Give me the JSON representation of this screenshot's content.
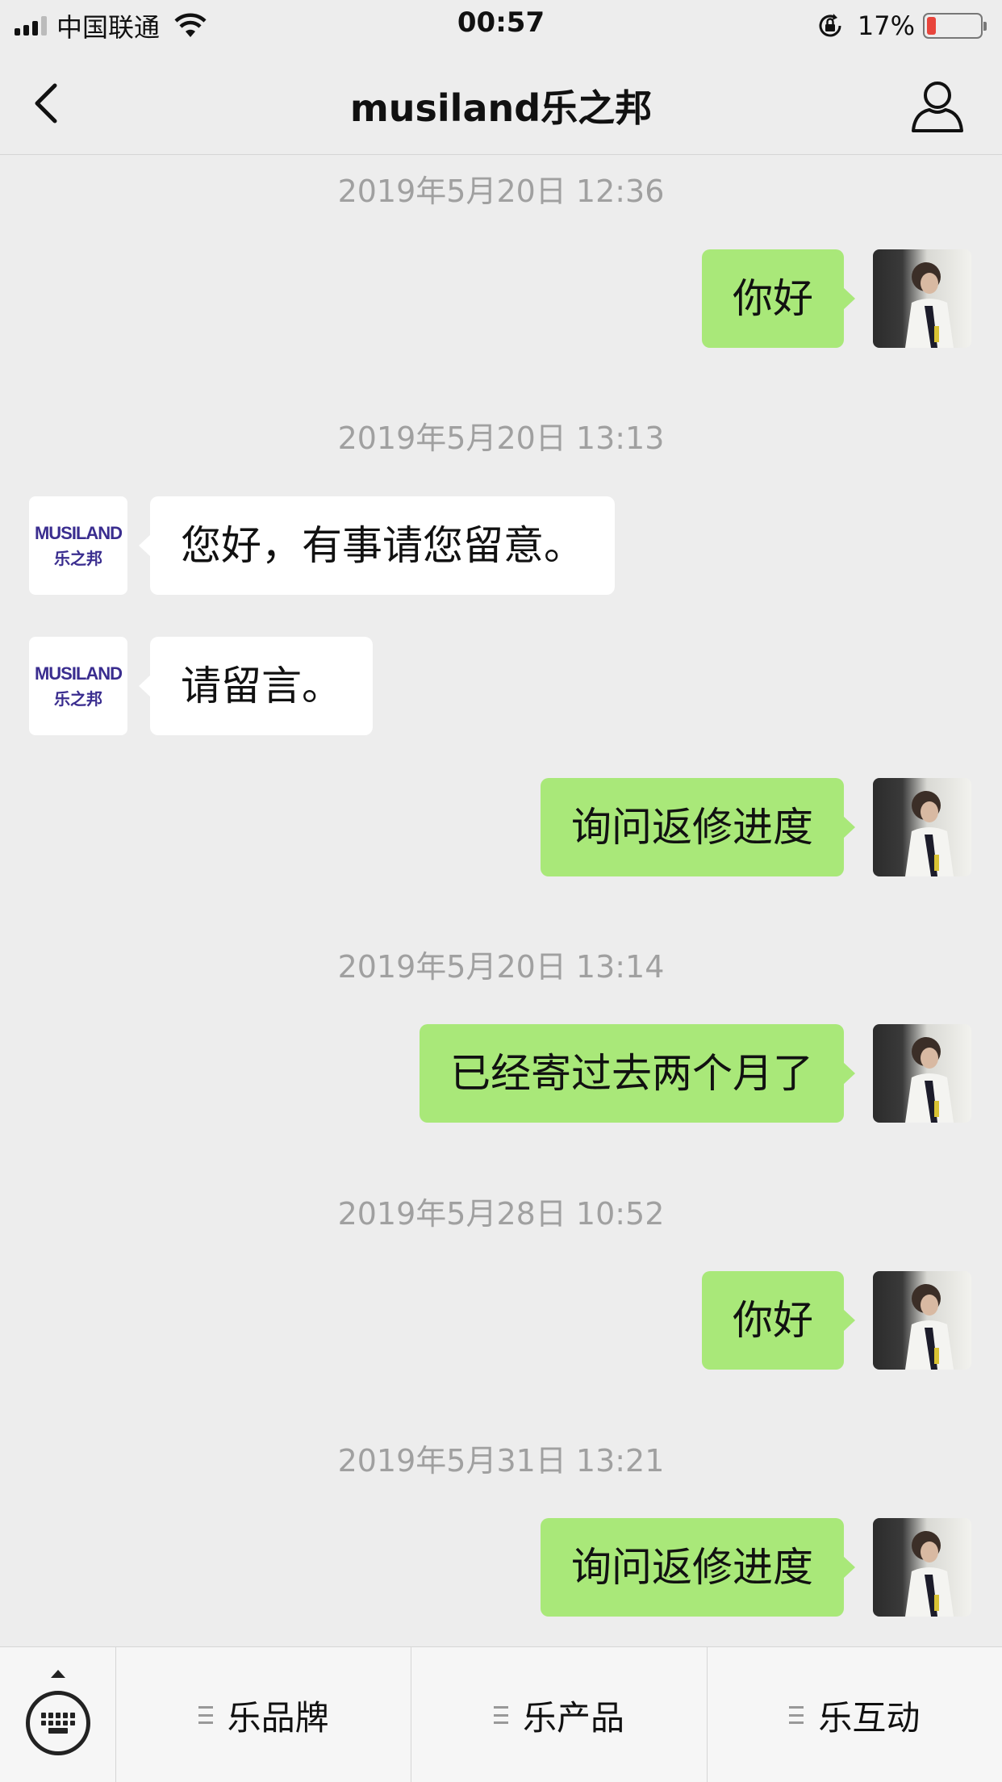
{
  "status_bar": {
    "carrier": "中国联通",
    "time": "00:57",
    "battery_percent": "17%",
    "battery_level": 0.17,
    "icons": [
      "signal-icon",
      "wifi-icon",
      "rotation-lock-icon",
      "battery-icon"
    ]
  },
  "nav": {
    "title": "musiland乐之邦",
    "back_icon": "chevron-left-icon",
    "profile_icon": "person-icon"
  },
  "brand_avatar": {
    "top": "MUSILAND",
    "bottom": "乐之邦"
  },
  "messages": [
    {
      "type": "timestamp",
      "text": "2019年5月20日 12:36"
    },
    {
      "type": "out",
      "text": "你好"
    },
    {
      "type": "timestamp",
      "text": "2019年5月20日 13:13"
    },
    {
      "type": "in",
      "text": "您好，有事请您留意。"
    },
    {
      "type": "in",
      "text": "请留言。"
    },
    {
      "type": "out",
      "text": "询问返修进度"
    },
    {
      "type": "timestamp",
      "text": "2019年5月20日 13:14"
    },
    {
      "type": "out",
      "text": "已经寄过去两个月了"
    },
    {
      "type": "timestamp",
      "text": "2019年5月28日 10:52"
    },
    {
      "type": "out",
      "text": "你好"
    },
    {
      "type": "timestamp",
      "text": "2019年5月31日 13:21"
    },
    {
      "type": "out",
      "text": "询问返修进度"
    }
  ],
  "bottom_menu": {
    "keyboard_icon": "keyboard-icon",
    "items": [
      {
        "label": "乐品牌"
      },
      {
        "label": "乐产品"
      },
      {
        "label": "乐互动"
      }
    ]
  },
  "colors": {
    "background": "#ededed",
    "outgoing_bubble": "#a9e879",
    "incoming_bubble": "#ffffff",
    "timestamp_text": "#a0a0a0",
    "brand": "#3a2d8f",
    "battery_low": "#e8453c"
  }
}
